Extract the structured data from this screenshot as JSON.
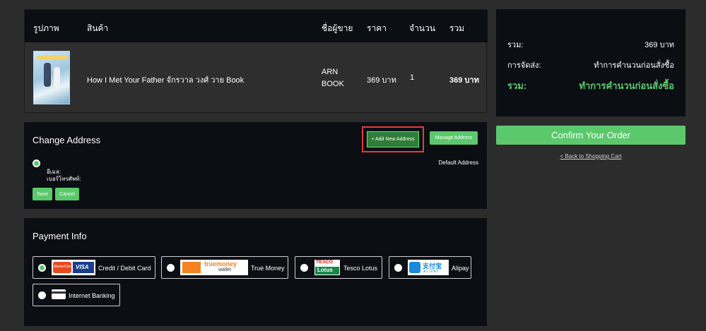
{
  "cart": {
    "headers": [
      "รูปภาพ",
      "สินค้า",
      "ชื่อผู้ขาย",
      "ราคา",
      "จำนวน",
      "รวม"
    ],
    "item": {
      "name": "How I Met Your Father จักรวาล วงศ์ วาย Book",
      "seller_line1": "ARN",
      "seller_line2": "BOOK",
      "price": "369 บาท",
      "qty": "1",
      "total": "369 บาท"
    }
  },
  "summary": {
    "subtotal_label": "รวม:",
    "subtotal_value": "369 บาท",
    "shipping_label": "การจัดส่ง:",
    "shipping_value": "ทำการคำนวนก่อนสั่งซื้อ",
    "total_label": "รวม:",
    "total_value": "ทำการคำนวนก่อนสั่งซื้อ",
    "confirm_label": "Confirm Your Order",
    "back_label": "< Back to Shopping Cart"
  },
  "address": {
    "title": "Change Address",
    "add_label": "+ Add New Address",
    "manage_label": "Manage Address",
    "email_label": "อีเมล:",
    "phone_label": "เบอร์โทรศัพท์:",
    "default_label": "Default Address",
    "save_label": "Save",
    "cancel_label": "Cancel"
  },
  "payment": {
    "title": "Payment Info",
    "options": [
      "Credit / Debit Card",
      "True Money",
      "Tesco Lotus",
      "Alipay",
      "Internet Banking"
    ],
    "logos": {
      "mastercard": "MasterCard",
      "visa": "VISA",
      "truemoney_top": "truemoney",
      "truemoney_bottom": "wallet",
      "tesco_top": "TESCO",
      "tesco_bottom": "Lotus",
      "alipay_top": "支付宝",
      "alipay_bottom": "ALIPAY"
    }
  },
  "colors": {
    "accent_green": "#5cc86c",
    "highlight_red": "#e23b3b",
    "panel_bg": "#0b0f14"
  }
}
